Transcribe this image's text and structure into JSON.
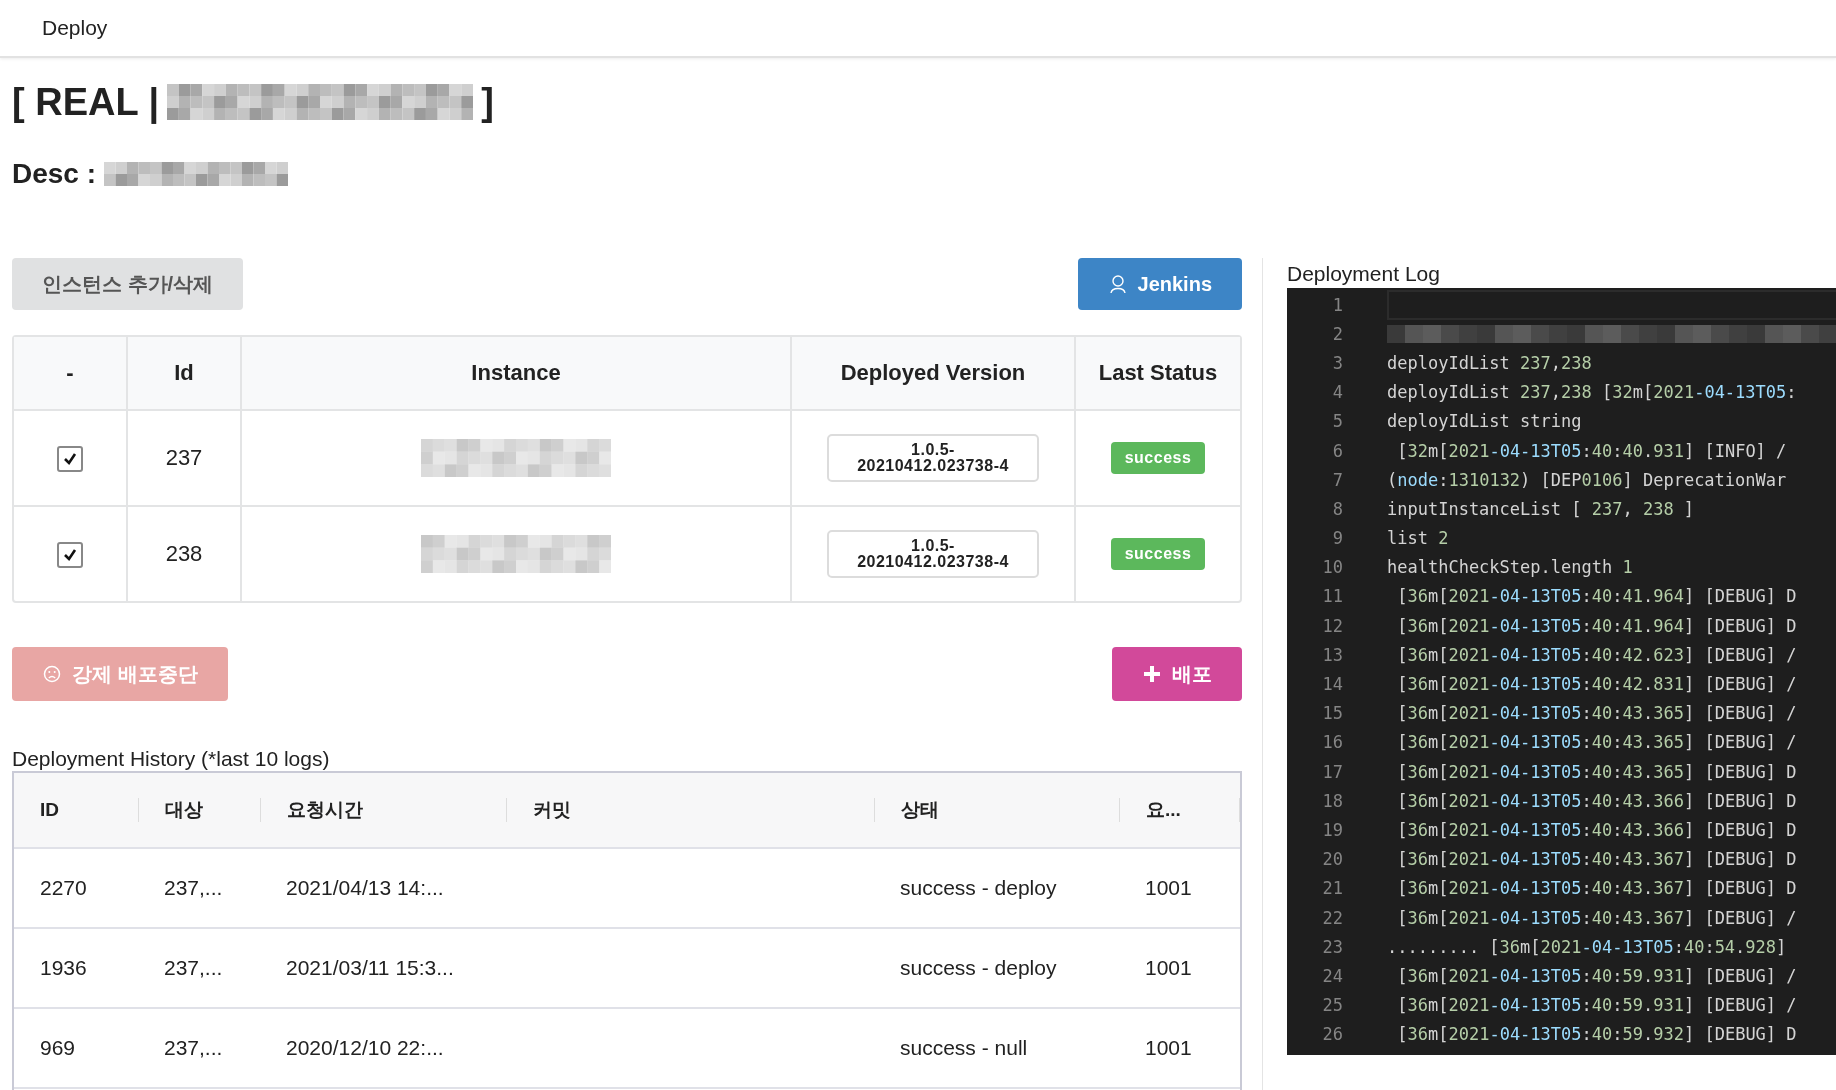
{
  "header": {
    "title": "Deploy"
  },
  "project": {
    "prefix": "[ REAL |",
    "suffix": "]",
    "desc_label": "Desc :"
  },
  "toolbar": {
    "manage_button": "인스턴스 추가/삭제",
    "jenkins_button": "Jenkins"
  },
  "instances": {
    "columns": [
      "-",
      "Id",
      "Instance",
      "Deployed Version",
      "Last Status"
    ],
    "rows": [
      {
        "checked": true,
        "id": "237",
        "version": "1.0.5-20210412.023738-4",
        "status": "success"
      },
      {
        "checked": true,
        "id": "238",
        "version": "1.0.5-20210412.023738-4",
        "status": "success"
      }
    ]
  },
  "actions": {
    "stop_button": "강제 배포중단",
    "deploy_button": "배포"
  },
  "history": {
    "title": "Deployment History (*last 10 logs)",
    "columns": [
      "ID",
      "대상",
      "요청시간",
      "커밋",
      "상태",
      "요..."
    ],
    "rows": [
      {
        "id": "2270",
        "target": "237,...",
        "requested": "2021/04/13 14:...",
        "status": "success - deploy",
        "requester": "1001"
      },
      {
        "id": "1936",
        "target": "237,...",
        "requested": "2021/03/11 15:3...",
        "status": "success - deploy",
        "requester": "1001"
      },
      {
        "id": "969",
        "target": "237,...",
        "requested": "2020/12/10 22:...",
        "status": "success - null",
        "requester": "1001"
      }
    ]
  },
  "log": {
    "title": "Deployment Log",
    "lines": [
      {
        "number": "1",
        "kind": "blank"
      },
      {
        "number": "2",
        "kind": "redacted"
      },
      {
        "number": "3",
        "kind": "text",
        "text": "deployIdList 237,238"
      },
      {
        "number": "4",
        "kind": "text",
        "text": "deployIdList 237,238 [32m[2021-04-13T05:"
      },
      {
        "number": "5",
        "kind": "text",
        "text": "deployIdList string"
      },
      {
        "number": "6",
        "kind": "text",
        "text": " [32m[2021-04-13T05:40:40.931] [INFO] /"
      },
      {
        "number": "7",
        "kind": "text",
        "text": "(node:1310132) [DEP0106] DeprecationWar"
      },
      {
        "number": "8",
        "kind": "text",
        "text": "inputInstanceList [ 237, 238 ]"
      },
      {
        "number": "9",
        "kind": "text",
        "text": "list 2"
      },
      {
        "number": "10",
        "kind": "text",
        "text": "healthCheckStep.length 1"
      },
      {
        "number": "11",
        "kind": "text",
        "text": " [36m[2021-04-13T05:40:41.964] [DEBUG] D"
      },
      {
        "number": "12",
        "kind": "text",
        "text": " [36m[2021-04-13T05:40:41.964] [DEBUG] D"
      },
      {
        "number": "13",
        "kind": "text",
        "text": " [36m[2021-04-13T05:40:42.623] [DEBUG] /"
      },
      {
        "number": "14",
        "kind": "text",
        "text": " [36m[2021-04-13T05:40:42.831] [DEBUG] /"
      },
      {
        "number": "15",
        "kind": "text",
        "text": " [36m[2021-04-13T05:40:43.365] [DEBUG] /"
      },
      {
        "number": "16",
        "kind": "text",
        "text": " [36m[2021-04-13T05:40:43.365] [DEBUG] /"
      },
      {
        "number": "17",
        "kind": "text",
        "text": " [36m[2021-04-13T05:40:43.365] [DEBUG] D"
      },
      {
        "number": "18",
        "kind": "text",
        "text": " [36m[2021-04-13T05:40:43.366] [DEBUG] D"
      },
      {
        "number": "19",
        "kind": "text",
        "text": " [36m[2021-04-13T05:40:43.366] [DEBUG] D"
      },
      {
        "number": "20",
        "kind": "text",
        "text": " [36m[2021-04-13T05:40:43.367] [DEBUG] D"
      },
      {
        "number": "21",
        "kind": "text",
        "text": " [36m[2021-04-13T05:40:43.367] [DEBUG] D"
      },
      {
        "number": "22",
        "kind": "text",
        "text": " [36m[2021-04-13T05:40:43.367] [DEBUG] /"
      },
      {
        "number": "23",
        "kind": "text",
        "text": "......... [36m[2021-04-13T05:40:54.928]"
      },
      {
        "number": "24",
        "kind": "text",
        "text": " [36m[2021-04-13T05:40:59.931] [DEBUG] /"
      },
      {
        "number": "25",
        "kind": "text",
        "text": " [36m[2021-04-13T05:40:59.931] [DEBUG] /"
      },
      {
        "number": "26",
        "kind": "text",
        "text": " [36m[2021-04-13T05:40:59.932] [DEBUG] D"
      }
    ]
  }
}
